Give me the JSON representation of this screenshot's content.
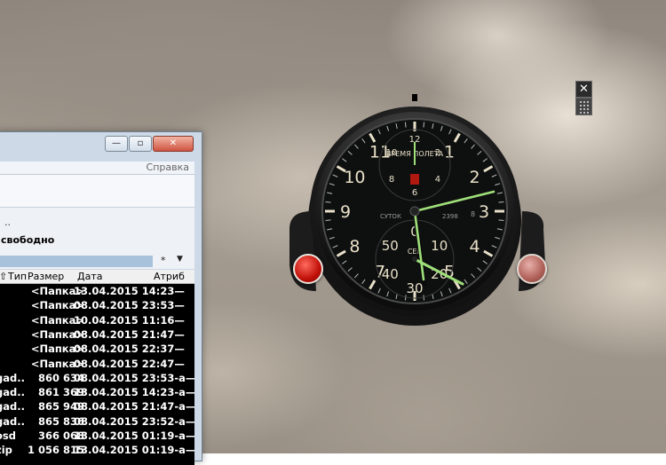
{
  "file_manager": {
    "menu": {
      "help": "Справка"
    },
    "drive_indicator": "..",
    "free_space": "свободно",
    "filter": {
      "star": "*",
      "arrow": "▼"
    },
    "columns": {
      "type": "Тип",
      "size": "Размер",
      "date": "Дата",
      "attr": "Атриб"
    },
    "rows": [
      {
        "name": "",
        "size": "<Папка>",
        "date": "13.04.2015 14:23—"
      },
      {
        "name": "",
        "size": "<Папка>",
        "date": "08.04.2015 23:53—"
      },
      {
        "name": "",
        "size": "<Папка>",
        "date": "10.04.2015 11:16—"
      },
      {
        "name": "",
        "size": "<Папка>",
        "date": "08.04.2015 21:47—"
      },
      {
        "name": "",
        "size": "<Папка>",
        "date": "08.04.2015 22:37—"
      },
      {
        "name": "",
        "size": "<Папка>",
        "date": "08.04.2015 22:47—"
      },
      {
        "name": "gad..",
        "size": "860 634",
        "date": "08.04.2015 23:53-a—"
      },
      {
        "name": "gad..",
        "size": "861 369",
        "date": "13.04.2015 14:23-a—"
      },
      {
        "name": "gad..",
        "size": "865 949",
        "date": "08.04.2015 21:47-a—"
      },
      {
        "name": "gad..",
        "size": "865 836",
        "date": "08.04.2015 23:52-a—"
      },
      {
        "name": "osd",
        "size": "366 068",
        "date": "13.04.2015 01:19-a—"
      },
      {
        "name": "zip",
        "size": "1 056 815",
        "date": "13.04.2015 01:19-a—"
      }
    ]
  },
  "clock": {
    "top_label": "ВРЕМЯ ПОЛЕТА",
    "left_label": "СУТОК",
    "right_label": "8",
    "serial": "2398",
    "sub_label": "СЕК",
    "hour_numbers": [
      "12",
      "1",
      "2",
      "3",
      "4",
      "5",
      "6",
      "7",
      "8",
      "9",
      "10",
      "11"
    ],
    "sub_numbers": [
      "0",
      "10",
      "20",
      "30",
      "40",
      "50"
    ],
    "top_sub_numbers": [
      "12",
      "2",
      "4",
      "6",
      "8",
      "10"
    ]
  },
  "gadget_controls": {
    "close": "✕"
  }
}
